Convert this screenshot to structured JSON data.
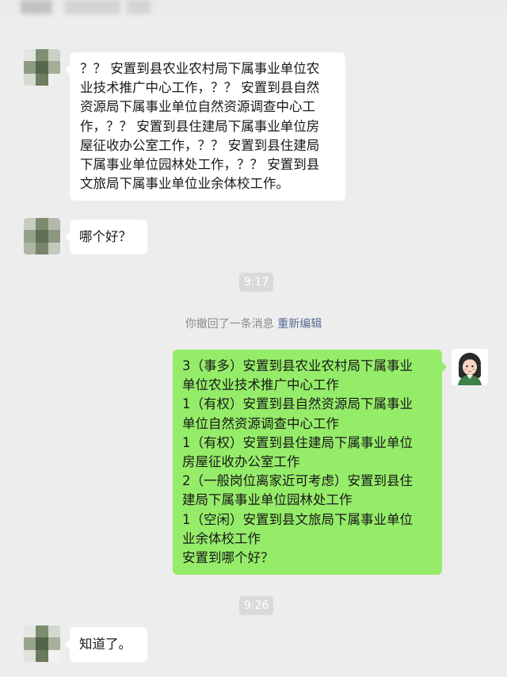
{
  "colors": {
    "background": "#ededed",
    "incoming_bubble": "#ffffff",
    "outgoing_bubble": "#95ec69",
    "timestamp_bg": "#dadada",
    "link": "#576b95"
  },
  "messages": [
    {
      "direction": "incoming",
      "avatar": "mosaic-avatar",
      "lines": [
        "？？ 安置到县农业农村局下属事业单位农",
        "业技术推广中心工作，？？ 安置到县自然",
        "资源局下属事业单位自然资源调查中心工",
        "作，？？ 安置到县住建局下属事业单位房",
        "屋征收办公室工作，？？ 安置到县住建局",
        "下属事业单位园林处工作，？？ 安置到县",
        "文旅局下属事业单位业余体校工作。"
      ]
    },
    {
      "direction": "incoming",
      "avatar": "mosaic-avatar",
      "lines": [
        "哪个好？"
      ]
    },
    {
      "direction": "outgoing",
      "avatar": "girl-avatar",
      "lines": [
        "3（事多）安置到县农业农村局下属事业",
        "单位农业技术推广中心工作",
        "1（有权）安置到县自然资源局下属事业",
        "单位自然资源调查中心工作",
        "1（有权）安置到县住建局下属事业单位",
        "房屋征收办公室工作",
        "2（一般岗位离家近可考虑）安置到县住",
        "建局下属事业单位园林处工作",
        "1（空闲）安置到县文旅局下属事业单位",
        "业余体校工作",
        "安置到哪个好？"
      ]
    },
    {
      "direction": "incoming",
      "avatar": "mosaic-avatar",
      "lines": [
        "知道了。"
      ]
    }
  ],
  "timestamps": [
    "9:17",
    "9:26"
  ],
  "recall_notice": {
    "text": "你撤回了一条消息",
    "action": "重新编辑"
  }
}
